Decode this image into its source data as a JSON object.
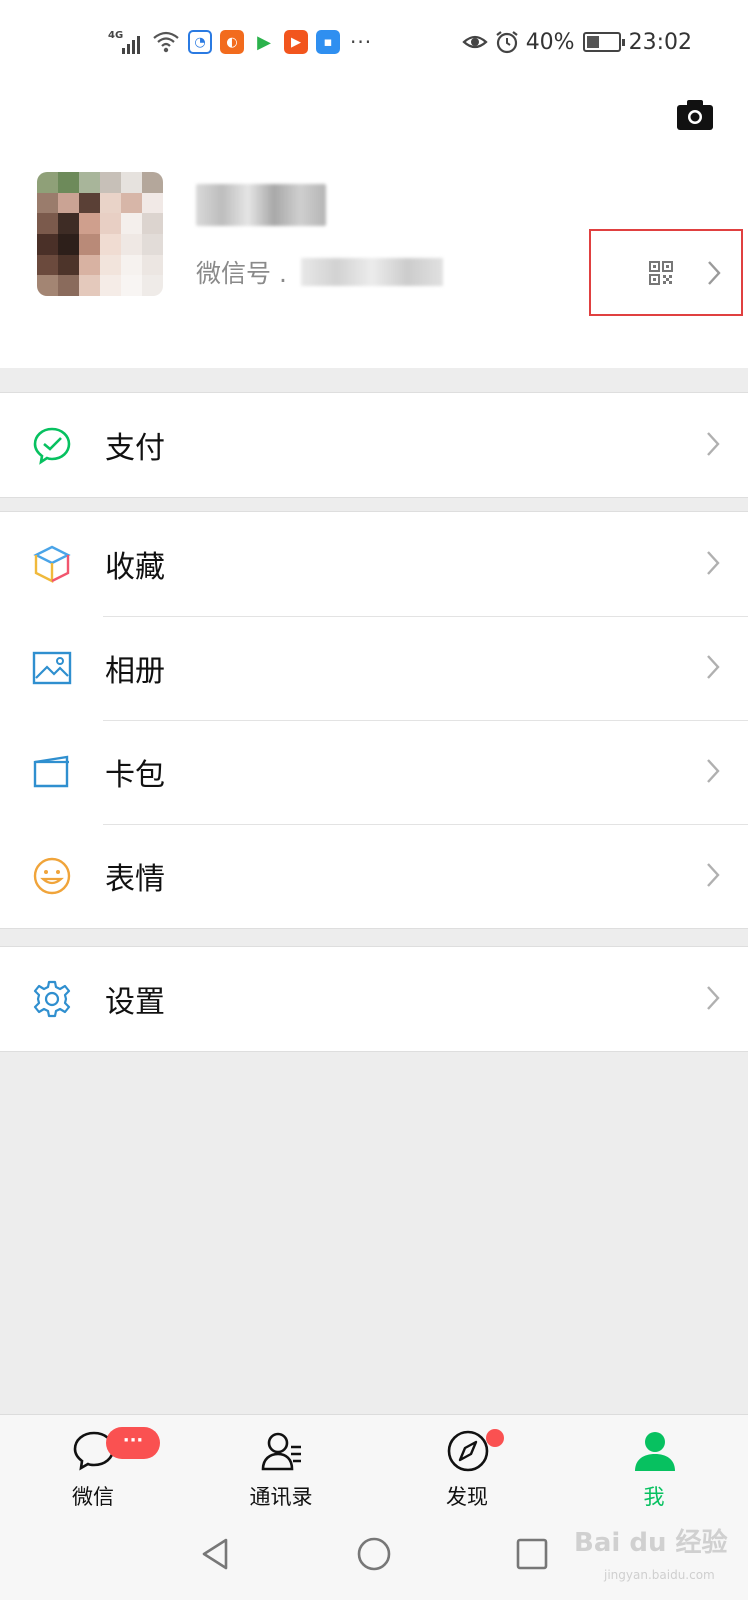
{
  "status_bar": {
    "network": "4G",
    "more": "···",
    "battery": "40%",
    "battery_level": 0.4,
    "time": "23:02"
  },
  "profile": {
    "wechat_id_label": "微信号 ."
  },
  "menu": {
    "pay": "支付",
    "favorites": "收藏",
    "album": "相册",
    "cards": "卡包",
    "stickers": "表情",
    "settings": "设置"
  },
  "tabbar": {
    "chats": "微信",
    "chats_badge": "···",
    "contacts": "通讯录",
    "discover": "发现",
    "me": "我"
  },
  "watermark": {
    "brand": "Bai du 经验",
    "url": "jingyan.baidu.com"
  },
  "colors": {
    "accent_green": "#07c160",
    "badge_red": "#fa5151",
    "highlight_box": "#e04040",
    "background": "#ededed"
  },
  "icons": {
    "camera": "camera-icon",
    "qr": "qr-code-icon",
    "pay": "pay-icon",
    "favorites": "favorites-cube-icon",
    "album": "album-image-icon",
    "cards": "card-wallet-icon",
    "stickers": "smiley-icon",
    "settings": "gear-icon"
  }
}
